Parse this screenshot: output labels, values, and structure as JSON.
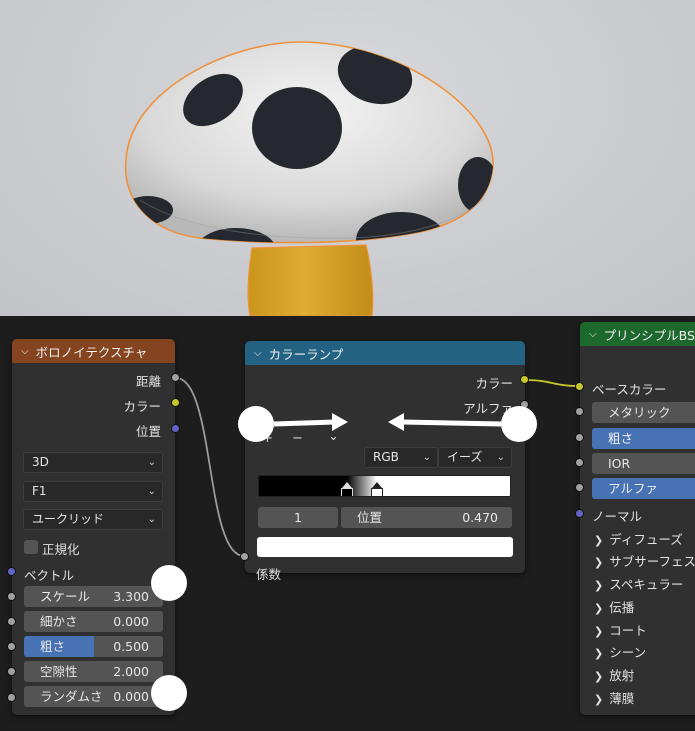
{
  "colors": {
    "voronoi_header": "#83441f",
    "colorramp_header": "#246283",
    "principled_header": "#1d682c",
    "socket_color": "#c7c729",
    "socket_vector": "#6363c7",
    "socket_float": "#a1a1a1",
    "highlight_blue": "#4772b3"
  },
  "voronoi": {
    "title": "ボロノイテクスチャ",
    "outputs": [
      "距離",
      "カラー",
      "位置"
    ],
    "dimension": "3D",
    "feature": "F1",
    "metric": "ユークリッド",
    "normalize_label": "正規化",
    "normalize_checked": false,
    "vector_label": "ベクトル",
    "fields": [
      {
        "label": "スケール",
        "value": "3.300",
        "fill": 0
      },
      {
        "label": "細かさ",
        "value": "0.000",
        "fill": 0
      },
      {
        "label": "粗さ",
        "value": "0.500",
        "fill": 0.5
      },
      {
        "label": "空隙性",
        "value": "2.000",
        "fill": 0
      },
      {
        "label": "ランダムさ",
        "value": "0.000",
        "fill": 0
      }
    ]
  },
  "colorramp": {
    "title": "カラーランプ",
    "outputs": [
      "カラー",
      "アルファ"
    ],
    "toolbar": {
      "add": "+",
      "remove": "−",
      "menu": "⌄"
    },
    "color_mode": "RGB",
    "interpolation": "イーズ",
    "stop_index": "1",
    "position_label": "位置",
    "position_value": "0.470",
    "stops": [
      0.35,
      0.47
    ],
    "input_label": "係数"
  },
  "principled": {
    "title": "プリンシプルBSDF",
    "base_color": "ベースカラー",
    "metallic": "メタリック",
    "roughness": "粗さ",
    "ior": "IOR",
    "alpha": "アルファ",
    "normal": "ノーマル",
    "panels": [
      "ディフューズ",
      "サブサーフェス",
      "スペキュラー",
      "伝播",
      "コート",
      "シーン",
      "放射",
      "薄膜"
    ]
  },
  "icons": {
    "collapse": "chevron-down-icon",
    "panel": "chevron-right-icon",
    "dropdown": "dropdown-arrow-icon"
  }
}
